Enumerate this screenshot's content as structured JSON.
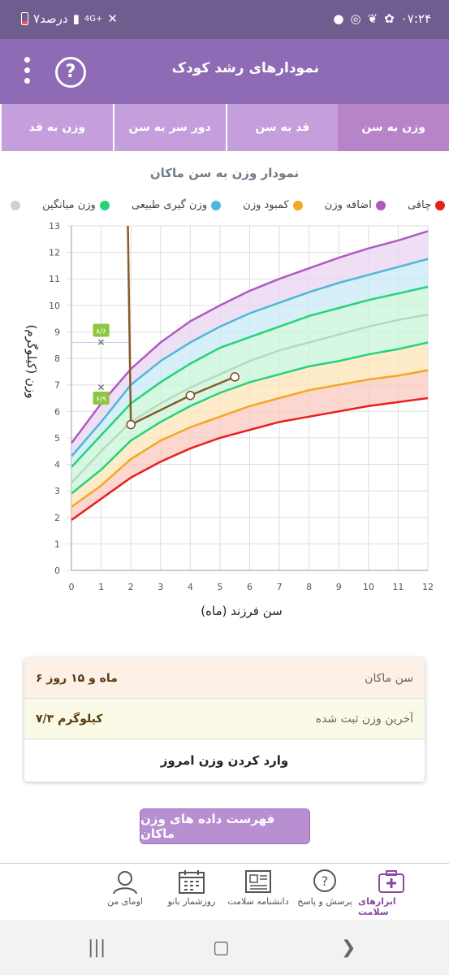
{
  "statusbar": {
    "time": "۰۷:۲۴",
    "battery": "۷درصد",
    "network": "4G+"
  },
  "header": {
    "title": "نمودارهای رشد کودک",
    "help_icon": "help-icon",
    "menu_icon": "more-vert-icon"
  },
  "tabs": [
    {
      "label": "وزن به سن",
      "active": true
    },
    {
      "label": "قد به سن",
      "active": false
    },
    {
      "label": "دور سر به سن",
      "active": false
    },
    {
      "label": "وزن به قد",
      "active": false
    }
  ],
  "chart_title": "نمودار وزن به سن ماکان",
  "legend": [
    {
      "label": "چاقی",
      "color": "#e8201e"
    },
    {
      "label": "اضافه وزن",
      "color": "#b05ac0"
    },
    {
      "label": "کمبود وزن",
      "color": "#f5a623"
    },
    {
      "label": "وزن گیری طبیعی",
      "color": "#4db8d8"
    },
    {
      "label": "وزن میانگین",
      "color": "#24d37a"
    }
  ],
  "legend_extra": {
    "label": "",
    "color": "#d0d0d0"
  },
  "chart_data": {
    "type": "line",
    "xlabel": "سن فرزند (ماه)",
    "ylabel": "وزن (کیلوگرم)",
    "xlim": [
      0,
      12
    ],
    "ylim": [
      0,
      13
    ],
    "x": [
      0,
      1,
      2,
      3,
      4,
      5,
      6,
      7,
      8,
      9,
      10,
      11,
      12
    ],
    "series": [
      {
        "color": "#e8201e",
        "values": [
          1.9,
          2.7,
          3.5,
          4.1,
          4.6,
          5.0,
          5.3,
          5.6,
          5.8,
          6.0,
          6.2,
          6.35,
          6.5
        ]
      },
      {
        "color": "#f5a623",
        "values": [
          2.4,
          3.2,
          4.2,
          4.9,
          5.4,
          5.8,
          6.2,
          6.5,
          6.8,
          7.0,
          7.2,
          7.35,
          7.55
        ]
      },
      {
        "color": "#24d37a",
        "values": [
          2.9,
          3.8,
          4.9,
          5.6,
          6.2,
          6.7,
          7.1,
          7.4,
          7.7,
          7.9,
          8.15,
          8.35,
          8.6
        ]
      },
      {
        "color": "#b8d8c0",
        "values": [
          3.3,
          4.5,
          5.6,
          6.3,
          6.9,
          7.4,
          7.9,
          8.3,
          8.6,
          8.9,
          9.2,
          9.45,
          9.65
        ]
      },
      {
        "color": "#24d37a",
        "values": [
          3.9,
          5.1,
          6.3,
          7.1,
          7.8,
          8.4,
          8.8,
          9.2,
          9.6,
          9.9,
          10.2,
          10.45,
          10.7
        ]
      },
      {
        "color": "#4db8d8",
        "values": [
          4.3,
          5.6,
          7.0,
          7.9,
          8.6,
          9.2,
          9.7,
          10.1,
          10.5,
          10.85,
          11.15,
          11.45,
          11.75
        ]
      },
      {
        "color": "#b05ac0",
        "values": [
          4.8,
          6.3,
          7.6,
          8.6,
          9.4,
          10.0,
          10.55,
          11.0,
          11.4,
          11.8,
          12.15,
          12.45,
          12.8
        ]
      }
    ],
    "child_series": {
      "points": [
        {
          "x": 2,
          "y": 5.5
        },
        {
          "x": 4,
          "y": 6.6
        },
        {
          "x": 5.5,
          "y": 7.3
        }
      ],
      "tail": {
        "x": 1.9,
        "y": 13
      }
    },
    "markers": [
      {
        "x": 1,
        "y": 8.6,
        "label": "۸/۶"
      },
      {
        "x": 1,
        "y": 6.9,
        "label": "۶/۹"
      }
    ]
  },
  "card": {
    "age_label": "سن ماکان",
    "age_value": "۶ ماه و ۱۵ روز",
    "weight_label": "آخرین وزن ثبت شده",
    "weight_value": "۷/۳ کیلوگرم",
    "enter_weight": "وارد کردن وزن امروز"
  },
  "list_button": "فهرست داده های وزن ماکان",
  "bottom_nav": [
    {
      "label": "ابزارهای سلامت",
      "icon": "medical-kit-icon",
      "active": true
    },
    {
      "label": "پرسش و پاسخ",
      "icon": "question-bubble-icon",
      "active": false
    },
    {
      "label": "دانشنامه سلامت",
      "icon": "newspaper-icon",
      "active": false
    },
    {
      "label": "روزشمار بانو",
      "icon": "calendar-icon",
      "active": false
    },
    {
      "label": "اومای من",
      "icon": "user-avatar-icon",
      "active": false
    }
  ]
}
